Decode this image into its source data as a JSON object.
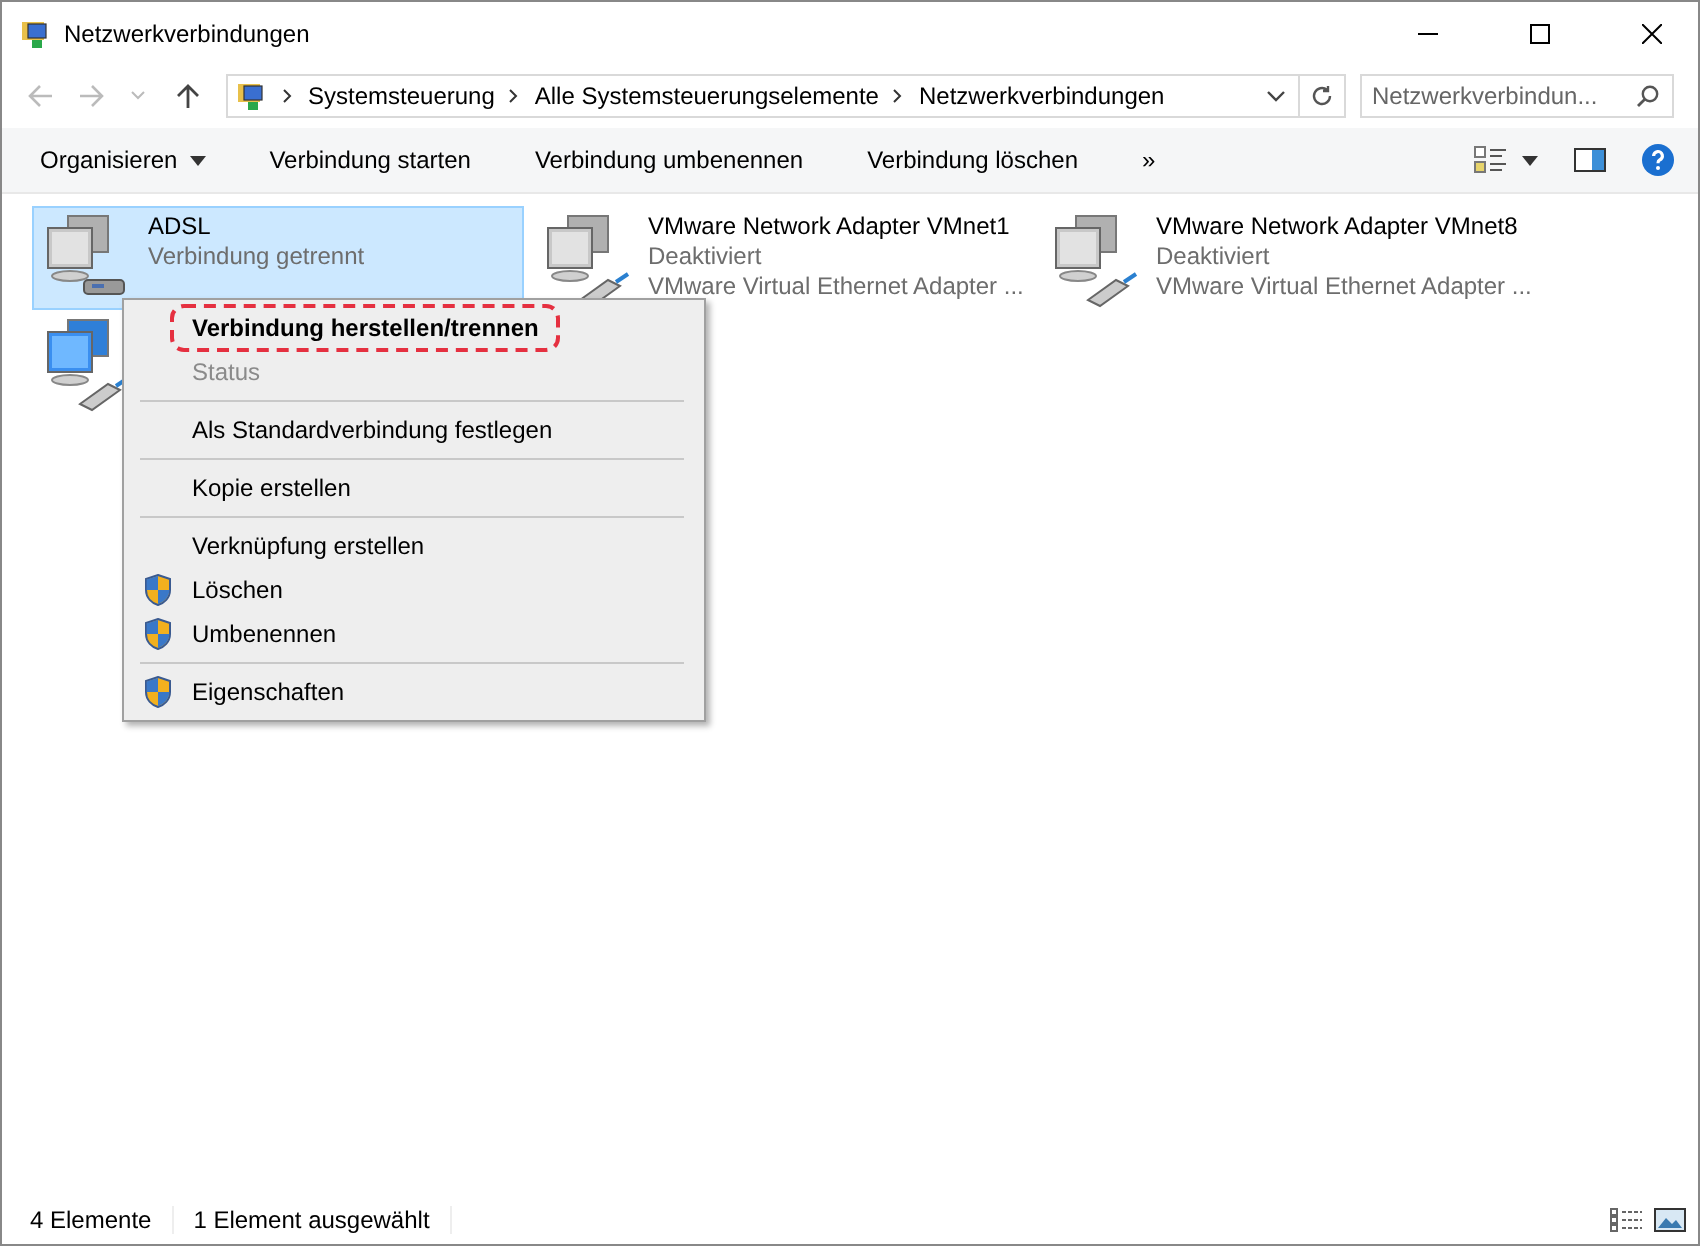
{
  "window": {
    "title": "Netzwerkverbindungen"
  },
  "address_bar": {
    "crumbs": [
      "Systemsteuerung",
      "Alle Systemsteuerungselemente",
      "Netzwerkverbindungen"
    ]
  },
  "search": {
    "placeholder": "Netzwerkverbindun..."
  },
  "toolbar": {
    "items": [
      "Organisieren",
      "Verbindung starten",
      "Verbindung umbenennen",
      "Verbindung löschen",
      "»"
    ]
  },
  "connections": [
    {
      "name": "ADSL",
      "status": "Verbindung getrennt",
      "selected": true,
      "kind": "modem"
    },
    {
      "name": "VMware Network Adapter VMnet1",
      "status": "Deaktiviert",
      "device": "VMware Virtual Ethernet Adapter ...",
      "selected": false,
      "kind": "ethernet"
    },
    {
      "name": "VMware Network Adapter VMnet8",
      "status": "Deaktiviert",
      "device": "VMware Virtual Ethernet Adapter ...",
      "selected": false,
      "kind": "ethernet"
    },
    {
      "selected": false,
      "kind": "ethernet-active"
    }
  ],
  "context_menu": [
    {
      "kind": "item",
      "label": "Verbindung herstellen/trennen",
      "bold": true,
      "disabled": false,
      "shield": false,
      "highlighted": true
    },
    {
      "kind": "item",
      "label": "Status",
      "bold": false,
      "disabled": true,
      "shield": false,
      "highlighted": false
    },
    {
      "kind": "separator"
    },
    {
      "kind": "item",
      "label": "Als Standardverbindung festlegen",
      "bold": false,
      "disabled": false,
      "shield": false,
      "highlighted": false
    },
    {
      "kind": "separator"
    },
    {
      "kind": "item",
      "label": "Kopie erstellen",
      "bold": false,
      "disabled": false,
      "shield": false,
      "highlighted": false
    },
    {
      "kind": "separator"
    },
    {
      "kind": "item",
      "label": "Verknüpfung erstellen",
      "bold": false,
      "disabled": false,
      "shield": false,
      "highlighted": false
    },
    {
      "kind": "item",
      "label": "Löschen",
      "bold": false,
      "disabled": false,
      "shield": true,
      "highlighted": false
    },
    {
      "kind": "item",
      "label": "Umbenennen",
      "bold": false,
      "disabled": false,
      "shield": true,
      "highlighted": false
    },
    {
      "kind": "separator"
    },
    {
      "kind": "item",
      "label": "Eigenschaften",
      "bold": false,
      "disabled": false,
      "shield": true,
      "highlighted": false
    }
  ],
  "status_bar": {
    "count": "4 Elemente",
    "selection": "1 Element ausgewählt"
  }
}
